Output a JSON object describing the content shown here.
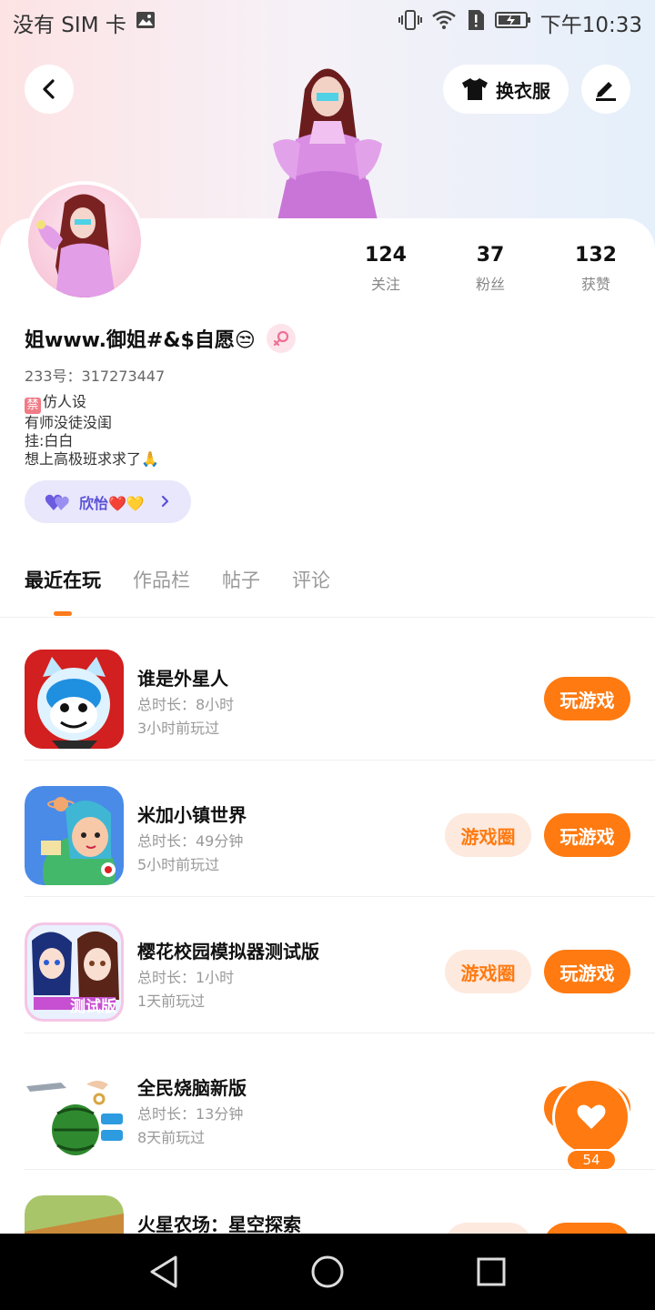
{
  "status_bar": {
    "carrier": "没有 SIM 卡",
    "time": "下午10:33",
    "icons": [
      "image-icon",
      "vibrate-icon",
      "wifi-icon",
      "alert-icon",
      "battery-icon"
    ]
  },
  "header": {
    "outfit_label": "换衣服"
  },
  "profile": {
    "stats": [
      {
        "value": "124",
        "label": "关注"
      },
      {
        "value": "37",
        "label": "粉丝"
      },
      {
        "value": "132",
        "label": "获赞"
      }
    ],
    "username": "姐www.御姐#&$自愿😒",
    "uid": "233号：317273447",
    "bio": {
      "ban_badge": "禁",
      "line1": "仿人设",
      "line2": "有师没徒没闺",
      "line3": "挂:白白",
      "line4": "想上高极班求求了🙏"
    },
    "tag_label": "欣怡❤️💛"
  },
  "tabs": [
    {
      "label": "最近在玩"
    },
    {
      "label": "作品栏"
    },
    {
      "label": "帖子"
    },
    {
      "label": "评论"
    }
  ],
  "games": [
    {
      "name": "谁是外星人",
      "duration": "总时长：8小时",
      "last_played": "3小时前玩过",
      "play": "玩游戏"
    },
    {
      "name": "米加小镇世界",
      "duration": "总时长：49分钟",
      "last_played": "5小时前玩过",
      "circle": "游戏圈",
      "play": "玩游戏"
    },
    {
      "name": "樱花校园模拟器测试版",
      "duration": "总时长：1小时",
      "last_played": "1天前玩过",
      "circle": "游戏圈",
      "play": "玩游戏",
      "icon_text": "测试版"
    },
    {
      "name": "全民烧脑新版",
      "duration": "总时长：13分钟",
      "last_played": "8天前玩过",
      "play": "玩游戏"
    },
    {
      "name": "火星农场：星空探索",
      "circle": "游戏圈",
      "play": "玩游戏"
    }
  ],
  "like_count": "54",
  "colors": {
    "accent": "#ff7a10",
    "accent_soft": "#fde9de",
    "tag_bg": "#e9e7fb",
    "tag_text": "#5b51d6"
  }
}
